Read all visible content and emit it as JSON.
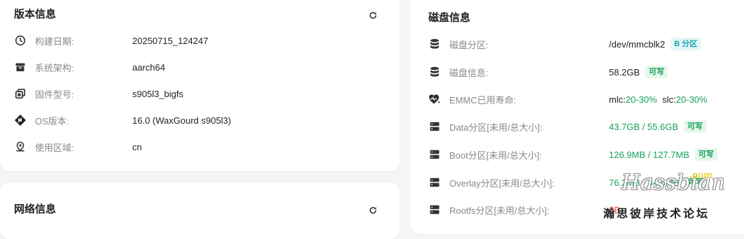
{
  "version_card": {
    "title": "版本信息",
    "items": [
      {
        "icon": "clock-icon",
        "label": "构建日期:",
        "value": "20250715_124247"
      },
      {
        "icon": "archive-box-icon",
        "label": "系统架构:",
        "value": "aarch64"
      },
      {
        "icon": "copy-layers-icon",
        "label": "固件型号:",
        "value": "s905l3_bigfs"
      },
      {
        "icon": "os-diamond-icon",
        "label": "OS版本:",
        "value": "16.0 (WaxGourd s905l3)"
      },
      {
        "icon": "location-pin-icon",
        "label": "使用区域:",
        "value": "cn"
      }
    ]
  },
  "network_card": {
    "title": "网络信息"
  },
  "disk_card": {
    "title": "磁盘信息",
    "items": [
      {
        "icon": "database-icon",
        "label": "磁盘分区:",
        "value": "/dev/mmcblk2",
        "badge": "B 分区"
      },
      {
        "icon": "database-icon",
        "label": "磁盘信息:",
        "value": "58.2GB",
        "badge": "可写"
      },
      {
        "icon": "heart-pulse-icon",
        "label": "EMMC已用寿命:",
        "mlc_label": "mlc:",
        "mlc_value": "20-30%",
        "slc_label": "slc:",
        "slc_value": "20-30%"
      },
      {
        "icon": "server-icon",
        "label": "Data分区[未用/总大小]:",
        "value": "43.7GB / 55.6GB",
        "badge": "可写"
      },
      {
        "icon": "server-icon",
        "label": "Boot分区[未用/总大小]:",
        "value": "126.9MB / 127.7MB",
        "badge": "可写"
      },
      {
        "icon": "server-icon",
        "label": "Overlay分区[未用/总大小]:",
        "value": "76.2MB / 84.5MB",
        "badge": "可写"
      },
      {
        "icon": "server-icon",
        "label": "Rootfs分区[未用/总大小]:",
        "value": "0B"
      }
    ]
  },
  "watermark": {
    "logo": "Hassbian",
    "suffix": ".com",
    "text": "瀚思彼岸技术论坛"
  }
}
